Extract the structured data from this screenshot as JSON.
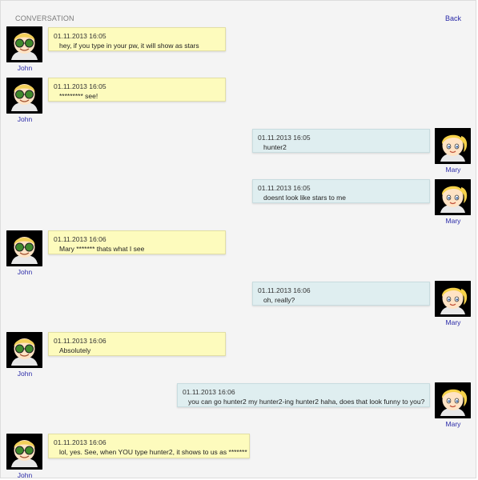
{
  "header": {
    "title": "CONVERSATION",
    "back_label": "Back"
  },
  "users": {
    "john": "John",
    "mary": "Mary"
  },
  "messages": [
    {
      "sender": "john",
      "timestamp": "01.11.2013 16:05",
      "text": "hey, if you type in your pw, it will show as stars"
    },
    {
      "sender": "john",
      "timestamp": "01.11.2013 16:05",
      "text": "********* see!"
    },
    {
      "sender": "mary",
      "timestamp": "01.11.2013 16:05",
      "text": "hunter2"
    },
    {
      "sender": "mary",
      "timestamp": "01.11.2013 16:05",
      "text": "doesnt look like stars to me"
    },
    {
      "sender": "john",
      "timestamp": "01.11.2013 16:06",
      "text": "Mary ******* thats what I see"
    },
    {
      "sender": "mary",
      "timestamp": "01.11.2013 16:06",
      "text": "oh, really?"
    },
    {
      "sender": "john",
      "timestamp": "01.11.2013 16:06",
      "text": "Absolutely"
    },
    {
      "sender": "mary",
      "timestamp": "01.11.2013 16:06",
      "text": "you can go hunter2 my hunter2-ing hunter2 haha, does that look funny to you?"
    },
    {
      "sender": "john",
      "timestamp": "01.11.2013 16:06",
      "text": "lol, yes. See, when YOU type hunter2, it shows to us as *******"
    }
  ],
  "colors": {
    "john_bubble": "#fdfbbd",
    "mary_bubble": "#dfeef0",
    "link": "#2a2aa8"
  }
}
